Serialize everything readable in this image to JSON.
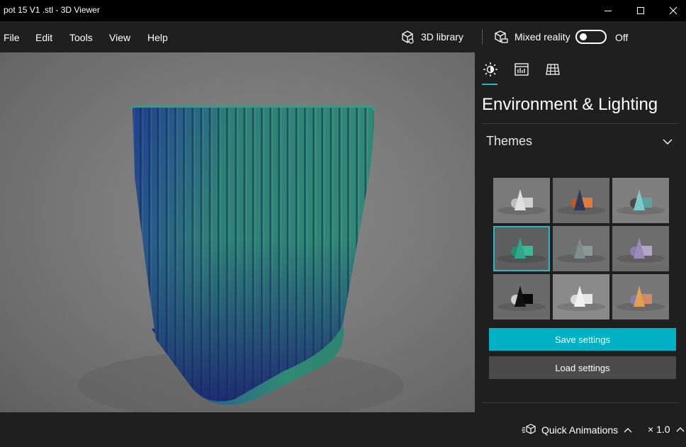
{
  "window": {
    "title": "pot 15 V1 .stl - 3D Viewer"
  },
  "menu": {
    "items": [
      "File",
      "Edit",
      "Tools",
      "View",
      "Help"
    ]
  },
  "toolbar": {
    "library_label": "3D library",
    "mixed_reality_label": "Mixed reality",
    "mixed_reality_state": "Off",
    "mixed_reality_on": false
  },
  "panel": {
    "tabs": [
      {
        "icon": "sun-icon",
        "active": true
      },
      {
        "icon": "stats-icon",
        "active": false
      },
      {
        "icon": "grid-icon",
        "active": false
      }
    ],
    "title": "Environment & Lighting",
    "section": {
      "label": "Themes",
      "expanded": true
    },
    "themes": [
      {
        "bg": "#7a7a7a",
        "a": "#e0e0e0",
        "b": "#d0d0d0",
        "c": "#bdbdbd",
        "selected": false
      },
      {
        "bg": "#6b6b6b",
        "a": "#2d3a5a",
        "b": "#e07a40",
        "c": "#b85a30",
        "selected": false
      },
      {
        "bg": "#7f7f7f",
        "a": "#7fc8c8",
        "b": "#5fa0a0",
        "c": "#4a4a4a",
        "selected": false
      },
      {
        "bg": "#5e5e5e",
        "a": "#2fa58a",
        "b": "#3bb89a",
        "c": "#2a8a6e",
        "selected": true
      },
      {
        "bg": "#6f6f6f",
        "a": "#7f8c8a",
        "b": "#8a9896",
        "c": "#6a7674",
        "selected": false
      },
      {
        "bg": "#6c6c6c",
        "a": "#9a8ab8",
        "b": "#b0a6c6",
        "c": "#8c7eaa",
        "selected": false
      },
      {
        "bg": "#6a6a6a",
        "a": "#111111",
        "b": "#0a0a0a",
        "c": "#cfcfcf",
        "selected": false
      },
      {
        "bg": "#8a8a8a",
        "a": "#f0f0f0",
        "b": "#e6e6e6",
        "c": "#d8d8d8",
        "selected": false
      },
      {
        "bg": "#777777",
        "a": "#e0a050",
        "b": "#d08a6a",
        "c": "#8a7ab0",
        "selected": false
      }
    ],
    "save_label": "Save settings",
    "load_label": "Load settings"
  },
  "bottom": {
    "quick_animations_label": "Quick Animations",
    "speed_label": "× 1.0"
  },
  "colors": {
    "accent": "#00b1c5",
    "panel_bg": "#1f1f1f",
    "model_teal": "#2f8a74",
    "model_blue": "#1e2f8a"
  }
}
